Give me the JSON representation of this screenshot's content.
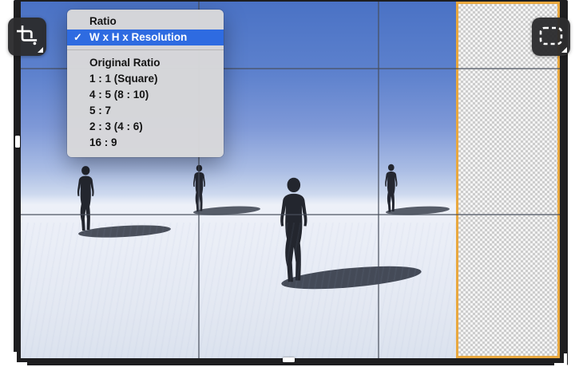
{
  "menu": {
    "header": "Ratio",
    "selected": {
      "check": "✓",
      "label": "W x H x Resolution"
    },
    "items": [
      "Original Ratio",
      "1 : 1 (Square)",
      "4 : 5 (8 : 10)",
      "5 : 7",
      "2 : 3 (4 : 6)",
      "16 : 9"
    ]
  },
  "toolbar": {
    "crop_tool_icon": "crop-icon",
    "selection_tool_icon": "marquee-icon"
  },
  "scene": {
    "figure_count": 4
  },
  "colors": {
    "menu_highlight": "#2E6BE1",
    "selection_orange": "#E9A83F",
    "frame": "#1E1E20",
    "tool_button": "#2C2C2E",
    "sky_top": "#4A72C5",
    "horizon": "#DFE6F4",
    "ground": "#E9EDF6"
  }
}
